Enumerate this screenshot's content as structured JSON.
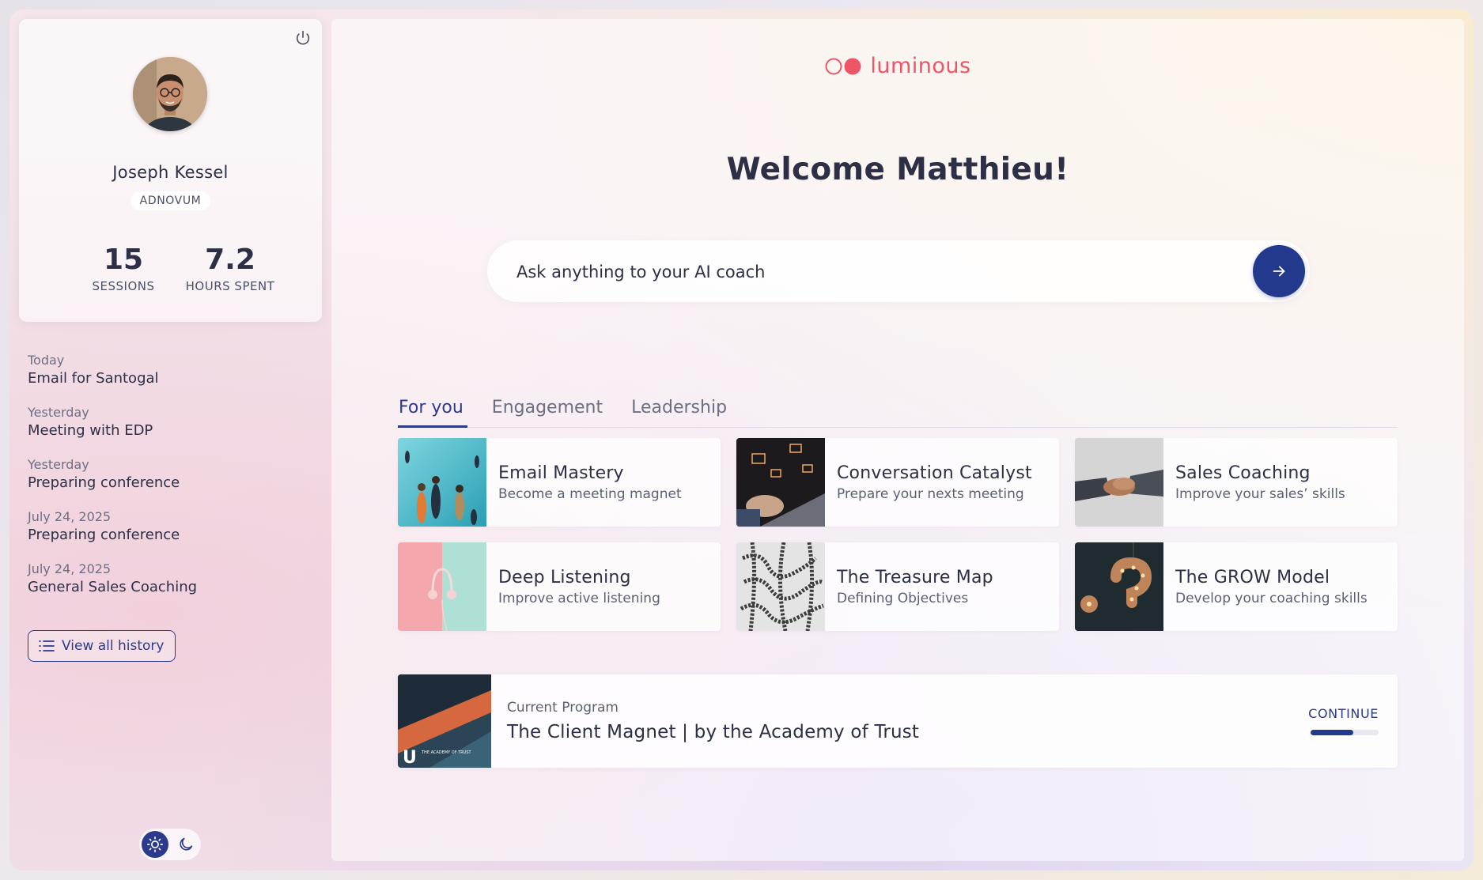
{
  "profile": {
    "name": "Joseph Kessel",
    "company": "ADNOVUM",
    "stats": [
      {
        "value": "15",
        "label": "SESSIONS"
      },
      {
        "value": "7.2",
        "label": "HOURS SPENT"
      }
    ]
  },
  "history": {
    "items": [
      {
        "date": "Today",
        "title": "Email for Santogal"
      },
      {
        "date": "Yesterday",
        "title": "Meeting with EDP"
      },
      {
        "date": "Yesterday",
        "title": "Preparing conference"
      },
      {
        "date": "July 24, 2025",
        "title": "Preparing conference"
      },
      {
        "date": "July 24, 2025",
        "title": "General Sales Coaching"
      }
    ],
    "view_all_label": "View all history"
  },
  "brand": {
    "name": "luminous",
    "color": "#ee5566"
  },
  "main": {
    "welcome": "Welcome Matthieu!",
    "ask_placeholder": "Ask anything to your AI coach",
    "tabs": [
      {
        "label": "For you",
        "active": true
      },
      {
        "label": "Engagement",
        "active": false
      },
      {
        "label": "Leadership",
        "active": false
      }
    ],
    "courses": [
      {
        "title": "Email Mastery",
        "subtitle": "Become a meeting magnet"
      },
      {
        "title": "Conversation Catalyst",
        "subtitle": "Prepare your nexts meeting"
      },
      {
        "title": "Sales Coaching",
        "subtitle": "Improve your sales’ skills"
      },
      {
        "title": "Deep Listening",
        "subtitle": "Improve active listening"
      },
      {
        "title": "The Treasure Map",
        "subtitle": "Defining Objectives"
      },
      {
        "title": "The GROW Model",
        "subtitle": "Develop your coaching skills"
      }
    ],
    "program": {
      "label": "Current Program",
      "title": "The Client Magnet | by the Academy of Trust",
      "continue_label": "CONTINUE",
      "progress": 0.63,
      "thumb_text": "THE ACADEMY OF TRUST"
    }
  },
  "colors": {
    "accent": "#23398e",
    "brand": "#ee5566",
    "text": "#2c2f45"
  }
}
